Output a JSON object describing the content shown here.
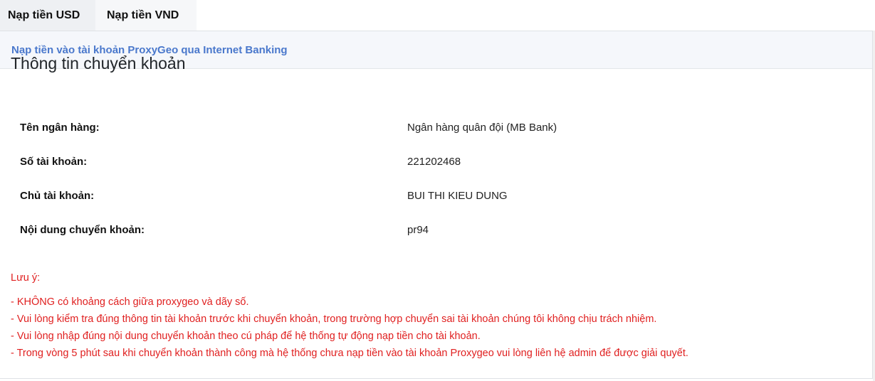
{
  "tabs": [
    {
      "label": "Nạp tiền USD"
    },
    {
      "label": "Nạp tiền VND"
    }
  ],
  "card": {
    "header": "Nạp tiền vào tài khoản ProxyGeo qua Internet Banking",
    "title": "Thông tin chuyển khoản",
    "rows": [
      {
        "label": "Tên ngân hàng:",
        "value": "Ngân hàng quân đội (MB Bank)"
      },
      {
        "label": "Số tài khoản:",
        "value": "221202468"
      },
      {
        "label": "Chủ tài khoản:",
        "value": "BUI THI KIEU DUNG"
      },
      {
        "label": "Nội dung chuyển khoản:",
        "value": "pr94"
      }
    ]
  },
  "notes": {
    "title": "Lưu ý:",
    "items": [
      "- KHÔNG có khoảng cách giữa proxygeo và dãy số.",
      "- Vui lòng kiểm tra đúng thông tin tài khoản trước khi chuyển khoản, trong trường hợp chuyển sai tài khoản chúng tôi không chịu trách nhiệm.",
      "- Vui lòng nhập đúng nội dung chuyển khoản theo cú pháp để hệ thống tự động nạp tiền cho tài khoản.",
      "- Trong vòng 5 phút sau khi chuyển khoản thành công mà hệ thống chưa nạp tiền vào tài khoản Proxygeo vui lòng liên hệ admin để được giải quyết."
    ]
  },
  "colors": {
    "accent": "#4a78cc",
    "warning": "#e02020"
  }
}
